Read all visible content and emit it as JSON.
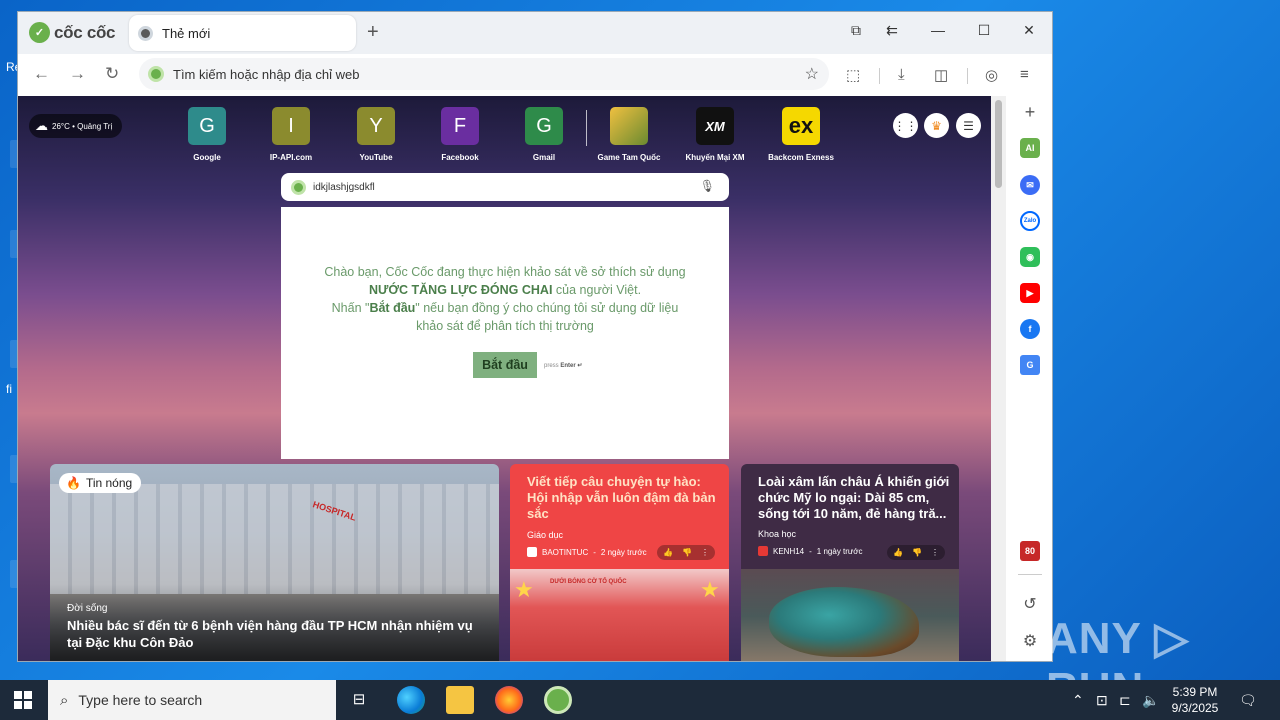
{
  "browser": {
    "brand": "cốc cốc",
    "tab_title": "Thẻ mới",
    "new_tab": "+",
    "address_placeholder": "Tìm kiếm hoặc nhập địa chỉ web"
  },
  "weather": "26°C • Quảng Trị",
  "shortcuts": [
    {
      "letter": "G",
      "label": "Google",
      "color": "#2e8b8b"
    },
    {
      "letter": "I",
      "label": "IP-API.com",
      "color": "#8b8b2e"
    },
    {
      "letter": "Y",
      "label": "YouTube",
      "color": "#8b8b2e"
    },
    {
      "letter": "F",
      "label": "Facebook",
      "color": "#6a2ea0"
    },
    {
      "letter": "G",
      "label": "Gmail",
      "color": "#2e8b4a"
    },
    {
      "letter": "",
      "label": "Game Tam Quốc",
      "color": "#c8a030"
    },
    {
      "letter": "XM",
      "label": "Khuyến Mại XM",
      "color": "#111111"
    },
    {
      "letter": "ex",
      "label": "Backcom Exness",
      "color": "#f5d800"
    }
  ],
  "search": {
    "value": "idkjlashjgsdkfl"
  },
  "survey": {
    "line1": "Chào bạn, Cốc Cốc đang thực hiện khảo sát về sở thích sử dụng",
    "line2_bold": "NƯỚC TĂNG LỰC ĐÓNG CHAI",
    "line2_rest": " của người Việt.",
    "line3_pre": "Nhấn \"",
    "line3_bold": "Bắt đầu",
    "line3_post": "\" nếu bạn đồng ý cho chúng tôi sử dụng dữ liệu",
    "line4": "khảo sát để phân tích thị trường",
    "button": "Bắt đầu",
    "hint_pre": "press ",
    "hint_key": "Enter ↵"
  },
  "news": {
    "hot_badge": "Tin nóng",
    "big": {
      "category": "Đời sống",
      "title": "Nhiều bác sĩ đến từ 6 bệnh viện hàng đầu TP HCM nhận nhiệm vụ tại Đặc khu Côn Đảo",
      "sign": "HOSPITAL"
    },
    "red": {
      "title": "Viết tiếp câu chuyện tự hào: Hội nhập vẫn luôn đậm đà bản sắc",
      "category": "Giáo dục",
      "source": "BAOTINTUC",
      "time": "2 ngày trước",
      "banner": "DƯỚI BÓNG CỜ TỔ QUỐC"
    },
    "dark": {
      "title": "Loài xâm lấn châu Á khiến giới chức Mỹ lo ngại: Dài 85 cm, sống tới 10 năm, đẻ hàng tră...",
      "category": "Khoa học",
      "source": "KENH14",
      "time": "1 ngày trước"
    }
  },
  "taskbar": {
    "search_placeholder": "Type here to search",
    "time": "5:39 PM",
    "date": "9/3/2025"
  },
  "watermark": "ANY ▷ RUN"
}
